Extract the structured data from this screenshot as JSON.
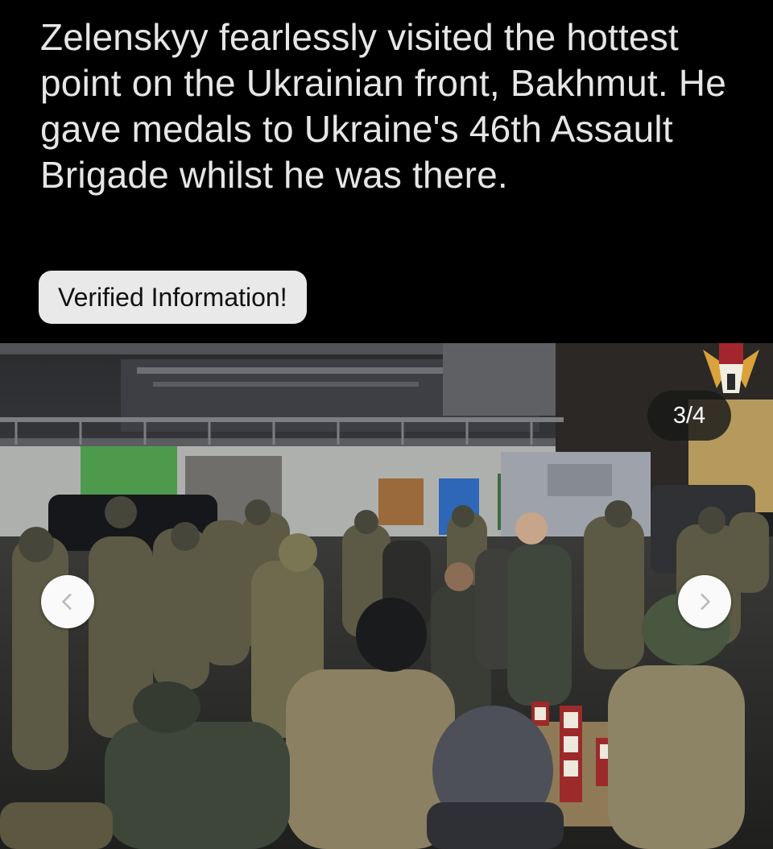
{
  "post": {
    "headline": "Zelenskyy fearlessly visited the hottest point on the Ukrainian front, Bakhmut. He gave medals to Ukraine's 46th Assault Brigade whilst he was there.",
    "badge_label": "Verified Information!"
  },
  "gallery": {
    "counter": "3/4",
    "prev_icon": "chevron-left-icon",
    "next_icon": "chevron-right-icon",
    "logo_icon": "brigade-helmet-wings-logo"
  },
  "colors": {
    "background": "#000000",
    "headline_text": "#e6e6e6",
    "badge_bg": "#e9e9e9",
    "counter_bg": "#191919",
    "nav_button_bg": "#fafafa",
    "logo_gold": "#d9a23a",
    "logo_red": "#a3262e"
  }
}
